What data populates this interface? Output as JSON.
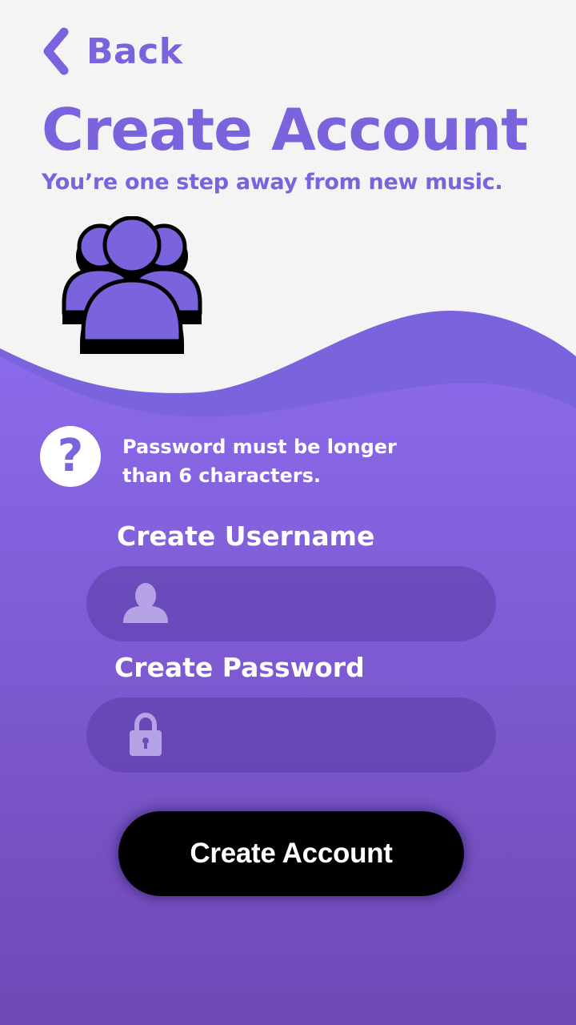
{
  "colors": {
    "accent": "#7a63dc",
    "background_top": "#f4f4f4",
    "background_gradient_top": "#8b6aeb",
    "background_gradient_bottom": "#6e48b4",
    "button_background": "#000000",
    "field_background": "#6a4fb5"
  },
  "header": {
    "back_label": "Back",
    "back_icon": "chevron-left-icon",
    "title": "Create Account",
    "subtitle": "You’re one step away from new music."
  },
  "hero": {
    "icon": "user-group-icon"
  },
  "help": {
    "icon": "question-mark-icon",
    "icon_glyph": "?",
    "line1": "Password must be longer",
    "line2": "than 6 characters."
  },
  "form": {
    "username": {
      "label": "Create Username",
      "icon": "user-icon",
      "value": "",
      "placeholder": ""
    },
    "password": {
      "label": "Create Password",
      "icon": "lock-icon",
      "value": "",
      "placeholder": ""
    },
    "submit_label": "Create Account"
  }
}
